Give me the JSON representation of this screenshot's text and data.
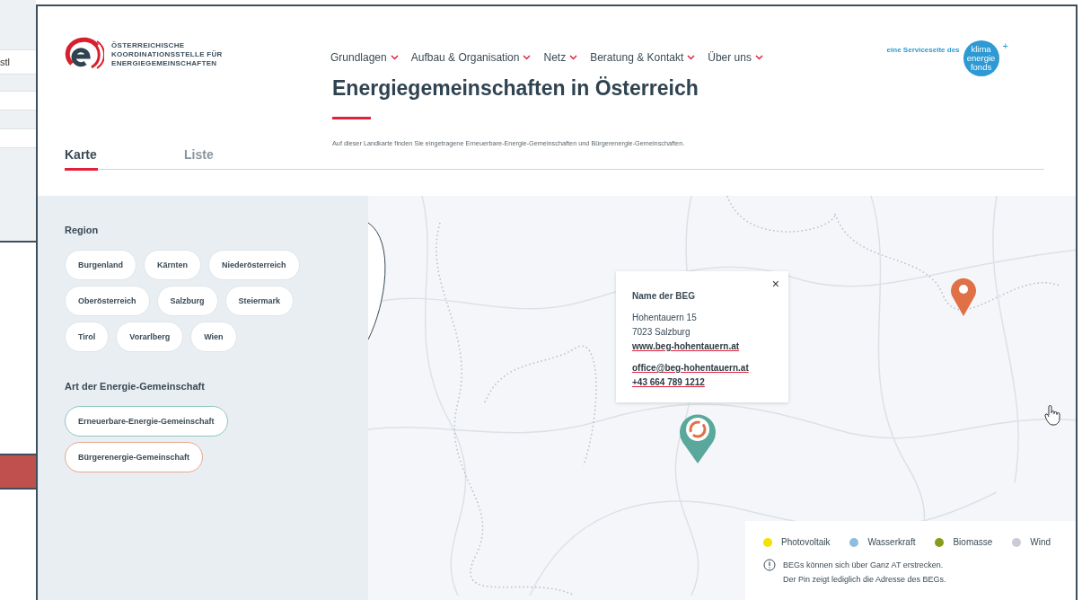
{
  "background_window": {
    "fragment": "stl"
  },
  "header": {
    "logo_text": [
      "ÖSTERREICHISCHE",
      "KOORDINATIONSSTELLE FÜR",
      "ENERGIEGEMEINSCHAFTEN"
    ],
    "nav": [
      "Grundlagen",
      "Aufbau & Organisation",
      "Netz",
      "Beratung & Kontakt",
      "Über uns"
    ],
    "service_text": "eine Serviceseite des",
    "partner_logo": {
      "lines": [
        "klima",
        "energie",
        "fonds"
      ],
      "plus": "+"
    }
  },
  "title": "Energiegemeinschaften in Österreich",
  "description": "Auf dieser Landkarte finden Sie eingetragene Erneuerbare-Energie-Gemeinschaften und Bürgerenergie-Gemeinschaften.",
  "tabs": [
    {
      "label": "Karte",
      "selected": true
    },
    {
      "label": "Liste",
      "selected": false
    }
  ],
  "filters": {
    "region_title": "Region",
    "regions": [
      {
        "label": "Burgenland",
        "selected": false
      },
      {
        "label": "Kärnten",
        "selected": false
      },
      {
        "label": "Niederösterreich",
        "selected": false
      },
      {
        "label": "Oberösterreich",
        "selected": false
      },
      {
        "label": "Salzburg",
        "selected": false
      },
      {
        "label": "Steiermark",
        "selected": false
      },
      {
        "label": "Tirol",
        "selected": false
      },
      {
        "label": "Vorarlberg",
        "selected": false
      },
      {
        "label": "Wien",
        "selected": false
      }
    ],
    "type_title": "Art der Energie-Gemeinschaft",
    "types": [
      {
        "label": "Erneuerbare-Energie-Gemeinschaft",
        "color": "#8cc7bd"
      },
      {
        "label": "Bürgerenergie-Gemeinschaft",
        "color": "#eaa68f"
      }
    ]
  },
  "popup": {
    "name": "Name der BEG",
    "address": [
      "Hohentauern 15",
      "7023 Salzburg"
    ],
    "links": [
      "www.beg-hohentauern.at",
      "office@beg-hohentauern.at",
      "+43 664 789 1212"
    ],
    "close": "×"
  },
  "pins": [
    {
      "kind": "ring",
      "color": "#5aa79b"
    },
    {
      "kind": "dot",
      "color": "#e07045"
    }
  ],
  "legend": {
    "items": [
      {
        "label": "Photovoltaik",
        "color": "#f5e000"
      },
      {
        "label": "Wasserkraft",
        "color": "#8fbde0"
      },
      {
        "label": "Biomasse",
        "color": "#8a9a1a"
      },
      {
        "label": "Wind",
        "color": "#c9cbd6"
      }
    ],
    "note": [
      "BEGs können sich über Ganz AT erstrecken.",
      "Der Pin zeigt lediglich die Adresse des BEGs."
    ]
  }
}
